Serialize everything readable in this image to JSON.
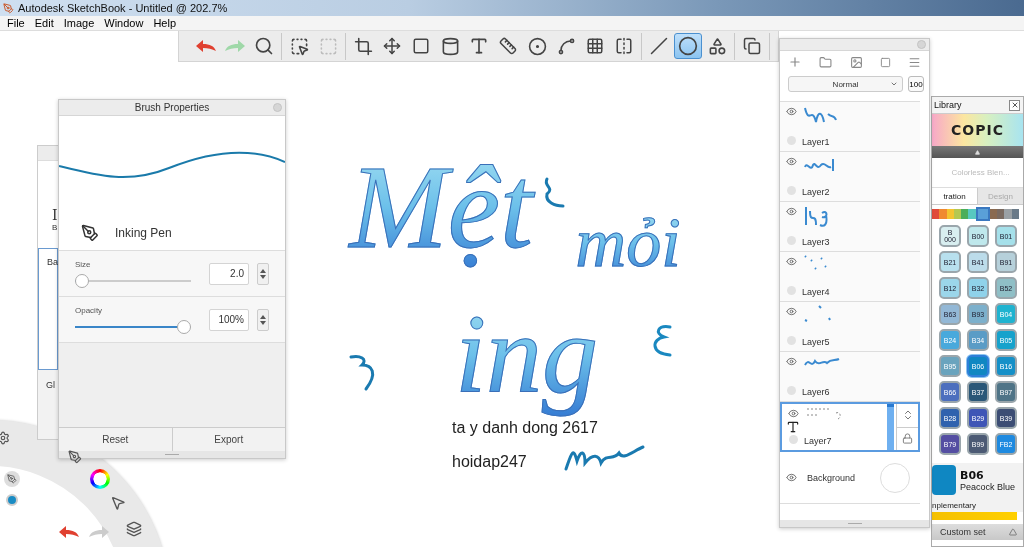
{
  "window": {
    "title": "Autodesk SketchBook - Untitled @ 202.7%"
  },
  "menu": [
    "File",
    "Edit",
    "Image",
    "Window",
    "Help"
  ],
  "toolbar": {
    "groups": [
      [
        {
          "kind": "undo",
          "selected": false
        },
        {
          "kind": "redo",
          "selected": false
        },
        {
          "kind": "zoom",
          "selected": false
        }
      ],
      [
        {
          "kind": "select",
          "selected": false
        },
        {
          "kind": "select_dashed",
          "selected": false
        }
      ],
      [
        {
          "kind": "crop",
          "selected": false
        },
        {
          "kind": "move",
          "selected": false
        },
        {
          "kind": "distort",
          "selected": false
        },
        {
          "kind": "fill",
          "selected": false
        },
        {
          "kind": "text",
          "selected": false
        },
        {
          "kind": "ruler",
          "selected": false
        },
        {
          "kind": "ellipse_guide",
          "selected": false
        },
        {
          "kind": "curve",
          "selected": false
        },
        {
          "kind": "perspective",
          "selected": false
        },
        {
          "kind": "symmetry",
          "selected": false
        }
      ],
      [
        {
          "kind": "stroke",
          "selected": false
        },
        {
          "kind": "ellipse",
          "selected": true
        },
        {
          "kind": "shapes",
          "selected": false
        }
      ],
      [
        {
          "kind": "copy",
          "selected": false
        }
      ]
    ]
  },
  "brush_library": {
    "texts": [
      "I",
      "B",
      "Ba",
      "Gl"
    ]
  },
  "brush_properties": {
    "title": "Brush Properties",
    "brush_name": "Inking Pen",
    "size": {
      "label": "Size",
      "level": 0.0,
      "value": "2.0"
    },
    "opacity": {
      "label": "Opacity",
      "level": 1.0,
      "value": "100%"
    },
    "buttons": [
      "Reset",
      "Export"
    ]
  },
  "canvas": {
    "lettering": [
      "Mệt",
      "mỏi",
      "ing"
    ],
    "texts": [
      "ta y danh dong 2617",
      "hoidap247"
    ]
  },
  "layers": {
    "blend_mode": "Normal",
    "opacity": "100",
    "items": [
      {
        "name": "Layer1",
        "kind": "paint",
        "selected": false
      },
      {
        "name": "Layer2",
        "kind": "paint",
        "selected": false
      },
      {
        "name": "Layer3",
        "kind": "paint",
        "selected": false
      },
      {
        "name": "Layer4",
        "kind": "paint",
        "selected": false
      },
      {
        "name": "Layer5",
        "kind": "paint",
        "selected": false
      },
      {
        "name": "Layer6",
        "kind": "paint",
        "selected": false
      },
      {
        "name": "Layer7",
        "kind": "text",
        "selected": true
      }
    ],
    "background": "Background"
  },
  "copic": {
    "title": "Library",
    "logo": "COPIC",
    "blender": "Colorless Blen...",
    "tabs": [
      {
        "label": "tration",
        "selected": true
      },
      {
        "label": "Design",
        "selected": false
      }
    ],
    "hues": [
      {
        "color": "#e04a3a",
        "selected": false
      },
      {
        "color": "#f08a30",
        "selected": false
      },
      {
        "color": "#f4c430",
        "selected": false
      },
      {
        "color": "#b6c850",
        "selected": false
      },
      {
        "color": "#4cae5a",
        "selected": false
      },
      {
        "color": "#58c8c0",
        "selected": false
      },
      {
        "color": "#5aa0d8",
        "selected": true
      },
      {
        "color": "#8a6a50",
        "selected": false
      },
      {
        "color": "#7a6a60",
        "selected": false
      },
      {
        "color": "#9aa0a4",
        "selected": false
      },
      {
        "color": "#6a7a88",
        "selected": false
      }
    ],
    "swatches": [
      {
        "code": "B 000",
        "color": "#d8eef0",
        "selected": false
      },
      {
        "code": "B00",
        "color": "#bfe8ec",
        "selected": false
      },
      {
        "code": "B01",
        "color": "#a5e0ea",
        "selected": false
      },
      {
        "code": "B21",
        "color": "#b8e0ee",
        "selected": false
      },
      {
        "code": "B41",
        "color": "#bcdcea",
        "selected": false
      },
      {
        "code": "B91",
        "color": "#b6d0da",
        "selected": false
      },
      {
        "code": "B12",
        "color": "#9bd6ea",
        "selected": false
      },
      {
        "code": "B32",
        "color": "#8fd2ea",
        "selected": false
      },
      {
        "code": "B52",
        "color": "#8fbfc6",
        "selected": false
      },
      {
        "code": "B63",
        "color": "#93b8d6",
        "selected": false
      },
      {
        "code": "B93",
        "color": "#7cb0cc",
        "selected": false
      },
      {
        "code": "B04",
        "color": "#1fb3d0",
        "selected": false
      },
      {
        "code": "B24",
        "color": "#48a9dc",
        "selected": false
      },
      {
        "code": "B34",
        "color": "#5a9cc6",
        "selected": false
      },
      {
        "code": "B05",
        "color": "#16a2cc",
        "selected": false
      },
      {
        "code": "B95",
        "color": "#6aa4be",
        "selected": false
      },
      {
        "code": "B06",
        "color": "#0f87c2",
        "selected": true
      },
      {
        "code": "B16",
        "color": "#1590c8",
        "selected": false
      },
      {
        "code": "B66",
        "color": "#4c6fbe",
        "selected": false
      },
      {
        "code": "B37",
        "color": "#2a5778",
        "selected": false
      },
      {
        "code": "B97",
        "color": "#4f7487",
        "selected": false
      },
      {
        "code": "B28",
        "color": "#2f62ae",
        "selected": false
      },
      {
        "code": "B29",
        "color": "#3e55b6",
        "selected": false
      },
      {
        "code": "B39",
        "color": "#3c4d74",
        "selected": false
      },
      {
        "code": "B79",
        "color": "#544ea2",
        "selected": false
      },
      {
        "code": "B99",
        "color": "#4c5a74",
        "selected": false
      },
      {
        "code": "FB2",
        "color": "#1e8ae0",
        "selected": false
      }
    ],
    "current": {
      "code": "B06",
      "name": "Peacock Blue",
      "color": "#0f87c2"
    },
    "complementary": "nplementary",
    "custom_set": "Custom set"
  }
}
